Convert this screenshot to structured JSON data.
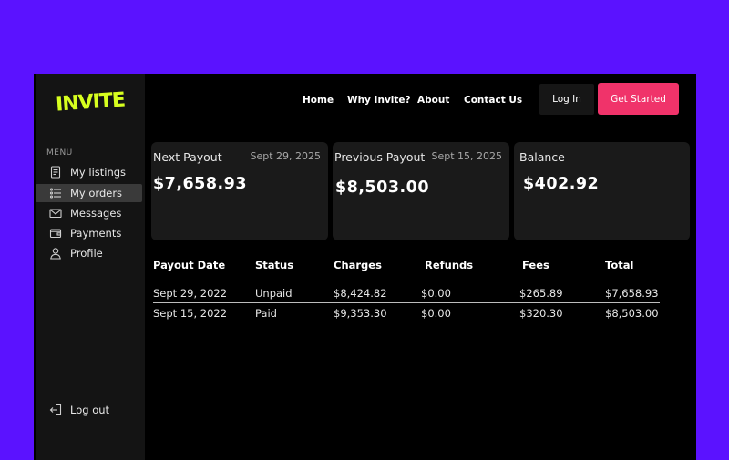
{
  "brand": {
    "logo_text": "INVITE",
    "accent_color": "#d7ff1f"
  },
  "colors": {
    "background": "#5b12ff",
    "primary_button": "#f0336a"
  },
  "sidebar": {
    "menu_label": "MENU",
    "items": [
      {
        "label": "My listings",
        "icon": "document-icon",
        "active": false
      },
      {
        "label": "My orders",
        "icon": "list-icon",
        "active": true
      },
      {
        "label": "Messages",
        "icon": "mail-icon",
        "active": false
      },
      {
        "label": "Payments",
        "icon": "wallet-icon",
        "active": false
      },
      {
        "label": "Profile",
        "icon": "user-icon",
        "active": false
      }
    ],
    "logout_label": "Log out"
  },
  "header": {
    "links": [
      "Home",
      "Why Invite?",
      "About",
      "Contact Us"
    ],
    "login_label": "Log In",
    "cta_label": "Get Started"
  },
  "cards": [
    {
      "title": "Next Payout",
      "date": "Sept 29, 2025",
      "amount": "$7,658.93"
    },
    {
      "title": "Previous Payout",
      "date": "Sept 15, 2025",
      "amount": "$8,503.00"
    },
    {
      "title": "Balance",
      "date": "",
      "amount": "$402.92"
    }
  ],
  "table": {
    "headers": [
      "Payout Date",
      "Status",
      "Charges",
      "Refunds",
      "Fees",
      "Total"
    ],
    "rows": [
      [
        "Sept 29, 2022",
        "Unpaid",
        "$8,424.82",
        "$0.00",
        "$265.89",
        "$7,658.93"
      ],
      [
        "Sept 15, 2022",
        "Paid",
        "$9,353.30",
        "$0.00",
        "$320.30",
        "$8,503.00"
      ]
    ]
  }
}
